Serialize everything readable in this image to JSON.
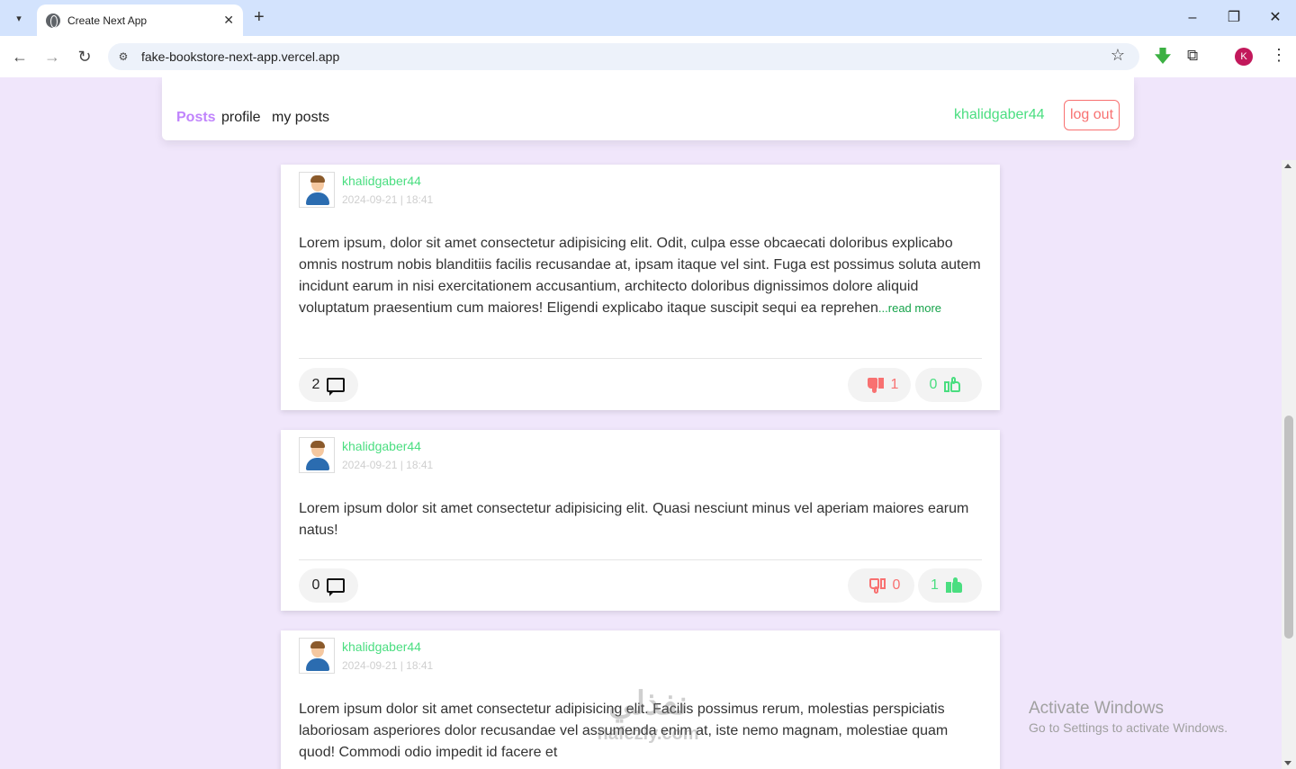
{
  "browser": {
    "tab_title": "Create Next App",
    "url": "fake-bookstore-next-app.vercel.app",
    "profile_initial": "K",
    "profile_color": "#c2185b"
  },
  "navbar": {
    "posts": "Posts",
    "profile": "profile",
    "my_posts": "my posts",
    "username": "khalidgaber44",
    "logout": "log out"
  },
  "colors": {
    "accent_purple": "#c084fc",
    "username_green": "#4ade80",
    "dislike_red": "#f87171",
    "page_bg": "#f0e6fb"
  },
  "posts": [
    {
      "author": "khalidgaber44",
      "date": "2024-09-21 | 18:41",
      "body": "Lorem ipsum, dolor sit amet consectetur adipisicing elit. Odit, culpa esse obcaecati doloribus explicabo omnis nostrum nobis blanditiis facilis recusandae at, ipsam itaque vel sint. Fuga est possimus soluta autem incidunt earum in nisi exercitationem accusantium, architecto doloribus dignissimos dolore aliquid voluptatum praesentium cum maiores! Eligendi explicabo itaque suscipit sequi ea reprehen",
      "read_more": "...read more",
      "comments": "2",
      "dislikes": "1",
      "likes": "0"
    },
    {
      "author": "khalidgaber44",
      "date": "2024-09-21 | 18:41",
      "body": "Lorem ipsum dolor sit amet consectetur adipisicing elit. Quasi nesciunt minus vel aperiam maiores earum natus!",
      "comments": "0",
      "dislikes": "0",
      "likes": "1"
    },
    {
      "author": "khalidgaber44",
      "date": "2024-09-21 | 18:41",
      "body": "Lorem ipsum dolor sit amet consectetur adipisicing elit. Facilis possimus rerum, molestias perspiciatis laboriosam asperiores dolor recusandae vel assumenda enim at, iste nemo magnam, molestiae quam quod! Commodi odio impedit id facere et"
    }
  ],
  "overlay": {
    "activate_title": "Activate Windows",
    "activate_sub": "Go to Settings to activate Windows.",
    "watermark": "نفذلي",
    "watermark_sub": "nafezly.com"
  },
  "icons": [
    "tab-search-icon",
    "globe-icon",
    "close-icon",
    "plus-icon",
    "minimize-icon",
    "restore-icon",
    "window-close-icon",
    "back-icon",
    "forward-icon",
    "reload-icon",
    "site-info-icon",
    "star-icon",
    "extension-icon",
    "puzzle-icon",
    "kebab-icon",
    "avatar-icon",
    "comment-icon",
    "thumbs-down-icon",
    "thumbs-up-icon"
  ]
}
